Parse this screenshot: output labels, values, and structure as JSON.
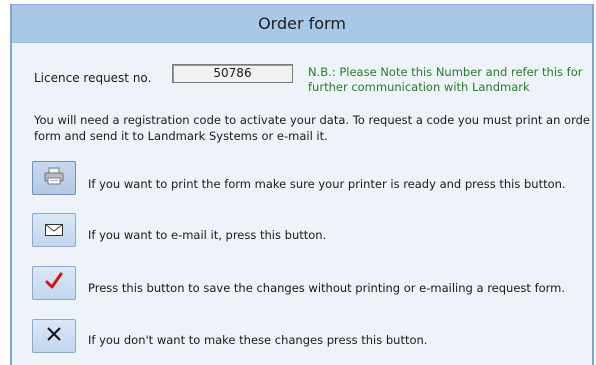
{
  "window": {
    "title": "Order form"
  },
  "licence": {
    "label": "Licence request no.",
    "number": "50786",
    "note_line1": "N.B.: Please Note this Number and refer this for",
    "note_line2": "further communication with Landmark"
  },
  "info": {
    "line1": "You will need a registration code to activate your data. To request a code you must print an orde",
    "line2": "form and send it to Landmark Systems or e-mail it."
  },
  "actions": {
    "print_text": "If you want to print the form make sure your printer is ready and press this button.",
    "email_text": "If you want to e-mail it, press this button.",
    "save_text": "Press this button to save the changes without printing or e-mailing a request form.",
    "cancel_text": "If you don't want to make these changes press this button."
  },
  "colors": {
    "titlebar": "#a9c8e8",
    "note_text": "#2a7a2a",
    "checkmark": "#d01818"
  },
  "icons": [
    "printer-icon",
    "envelope-icon",
    "checkmark-icon",
    "close-icon"
  ]
}
